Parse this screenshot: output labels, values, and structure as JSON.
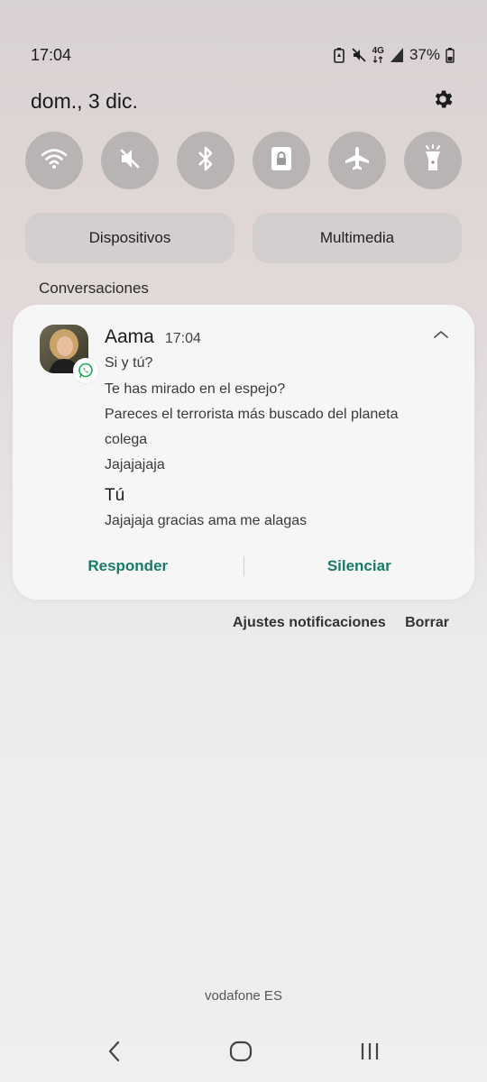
{
  "status_bar": {
    "time": "17:04",
    "network": "4G",
    "battery": "37%",
    "icons": [
      "battery-saver-icon",
      "mute-icon",
      "signal-4g-icon",
      "cell-signal-icon",
      "battery-icon"
    ]
  },
  "header": {
    "date": "dom., 3 dic.",
    "settings_icon": "gear-icon"
  },
  "quick_settings": [
    {
      "name": "wifi",
      "icon": "wifi-icon"
    },
    {
      "name": "sound",
      "icon": "mute-icon"
    },
    {
      "name": "bluetooth",
      "icon": "bluetooth-icon"
    },
    {
      "name": "rotation-lock",
      "icon": "rotation-lock-icon"
    },
    {
      "name": "airplane",
      "icon": "airplane-icon"
    },
    {
      "name": "flashlight",
      "icon": "flashlight-icon"
    }
  ],
  "pills": {
    "devices": "Dispositivos",
    "media": "Multimedia"
  },
  "section_title": "Conversaciones",
  "notification": {
    "sender": "Aama",
    "time": "17:04",
    "app_icon": "whatsapp-icon",
    "messages": [
      "Si y tú?",
      "Te has mirado en el espejo?",
      "Pareces el terrorista más buscado del planeta",
      "colega",
      "Jajajajaja"
    ],
    "reply_sender": "Tú",
    "reply_message": "Jajajaja gracias ama me alagas",
    "actions": {
      "reply": "Responder",
      "mute": "Silenciar"
    },
    "accent_color": "#1a7a68"
  },
  "footer_actions": {
    "settings": "Ajustes notificaciones",
    "clear": "Borrar"
  },
  "carrier": "vodafone ES",
  "nav": {
    "back_icon": "back-icon",
    "home_icon": "home-icon",
    "recents_icon": "recents-icon"
  }
}
